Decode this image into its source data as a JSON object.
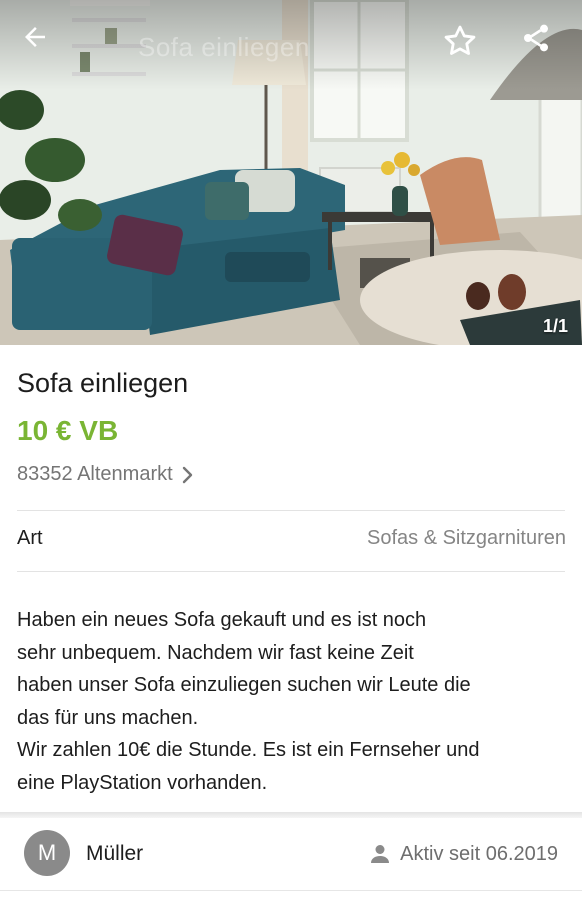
{
  "header": {
    "ghost_title": "Sofa einliegen",
    "image_counter": "1/1",
    "icons": {
      "back": "arrow-left-icon",
      "favorite": "star-outline-icon",
      "share": "share-icon"
    }
  },
  "listing": {
    "title": "Sofa einliegen",
    "price": "10 € VB",
    "location": "83352 Altenmarkt",
    "attributes": [
      {
        "key": "Art",
        "value": "Sofas & Sitzgarnituren"
      }
    ],
    "description": [
      "Haben ein neues Sofa gekauft und es ist noch",
      "sehr unbequem. Nachdem wir fast keine Zeit",
      "haben unser Sofa einzuliegen suchen wir Leute die",
      "das für uns machen.",
      "Wir zahlen 10€ die Stunde. Es ist ein Fernseher und",
      "eine PlayStation vorhanden."
    ]
  },
  "seller": {
    "initial": "M",
    "name": "Müller",
    "active_since": "Aktiv seit 06.2019"
  },
  "colors": {
    "price_green": "#7ab534",
    "muted_text": "#757575",
    "avatar_grey": "#8a8a8a"
  }
}
